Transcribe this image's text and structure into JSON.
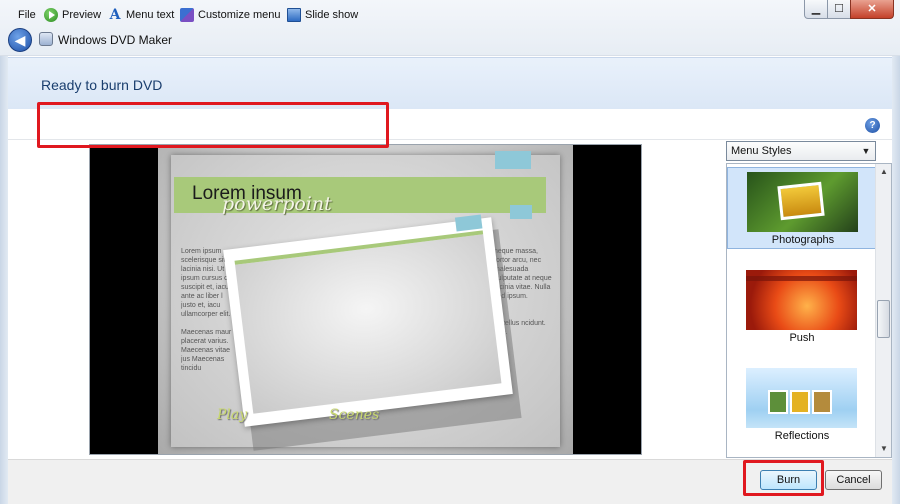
{
  "window": {
    "title": "Windows DVD Maker",
    "min_glyph": "▁",
    "max_glyph": "☐",
    "close_glyph": "✕"
  },
  "header": {
    "title": "Ready to burn DVD"
  },
  "toolbar": {
    "file_label": "File",
    "items": [
      {
        "label": "Preview",
        "icon": "preview-play-icon"
      },
      {
        "label": "Menu text",
        "icon": "menu-text-icon"
      },
      {
        "label": "Customize menu",
        "icon": "customize-menu-icon"
      },
      {
        "label": "Slide show",
        "icon": "slide-show-icon"
      }
    ],
    "help_glyph": "?"
  },
  "preview": {
    "title": "Lorem insum",
    "subtitle": "powerpoint",
    "left_paragraphs": [
      "Lorem ipsum scelerisque sit lacinia nisi. Ut ipsum cursus c suscipit et, iacu ante ac liber l justo et, iacu ullamcorper elit.",
      "Maecenas maur placerat varius. Maecenas vitae jus Maecenas tincidu"
    ],
    "right_paragraphs": [
      "neque massa, tortor arcu, nec malesuada vulputate at neque lacinia vitae. Nulla sed ipsum.",
      "tis tellus ncidunt. ede."
    ],
    "nav_play": "Play",
    "nav_scenes": "Scenes"
  },
  "menu_styles": {
    "selected": "Menu Styles",
    "dropdown_glyph": "▼",
    "items": [
      {
        "label": "Photographs",
        "selected": true
      },
      {
        "label": "Push",
        "selected": false
      },
      {
        "label": "Reflections",
        "selected": false
      }
    ],
    "scroll_up_glyph": "▲",
    "scroll_down_glyph": "▼"
  },
  "buttons": {
    "burn": "Burn",
    "cancel": "Cancel"
  },
  "colors": {
    "highlight": "#e0181f",
    "accent_green": "#a8c97a",
    "header_text": "#1a3e6e"
  }
}
